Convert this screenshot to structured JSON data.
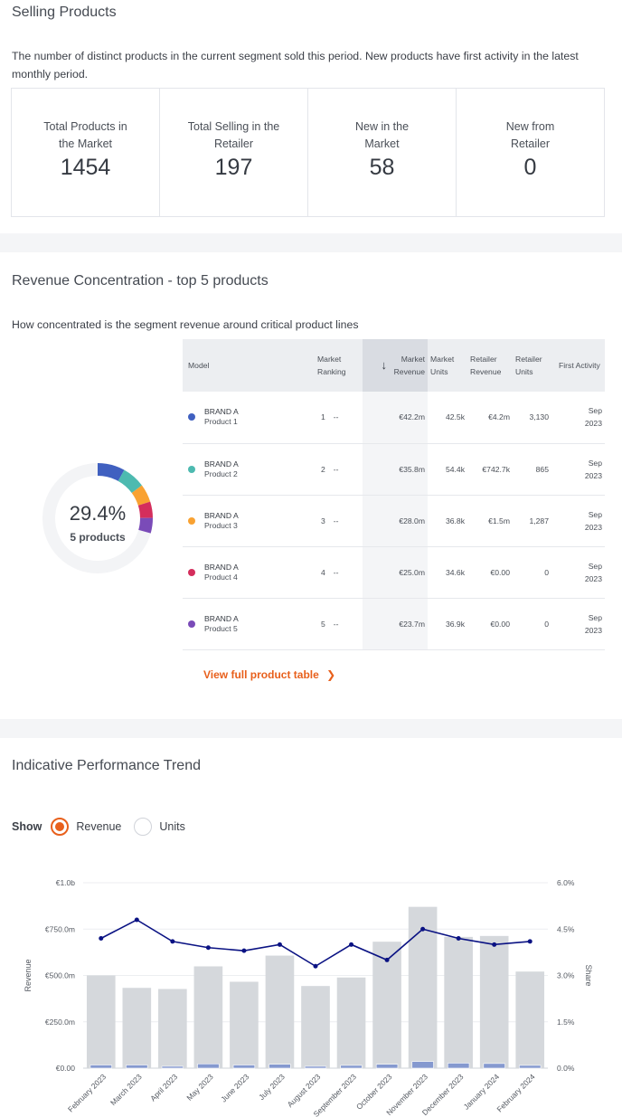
{
  "selling": {
    "title": "Selling Products",
    "description": "The number of distinct products in the current segment sold this period. New products have first activity in the latest monthly period.",
    "kpis": [
      {
        "label": "Total Products in the Market",
        "value": "1454"
      },
      {
        "label": "Total Selling in the Retailer",
        "value": "197"
      },
      {
        "label": "New in the Market",
        "value": "58"
      },
      {
        "label": "New from Retailer",
        "value": "0"
      }
    ]
  },
  "concentration": {
    "title": "Revenue Concentration - top 5 products",
    "description": "How concentrated is the segment revenue around critical product lines",
    "donut": {
      "share_label": "29.4%",
      "share": 0.294,
      "count_label": "5 products",
      "track_color": "#f3f4f6"
    },
    "columns": [
      "Model",
      "Market Ranking",
      "Market Revenue",
      "Market Units",
      "Retailer Revenue",
      "Retailer Units",
      "First Activity"
    ],
    "sort_icon": "arrow-down-icon",
    "rows": [
      {
        "brand": "BRAND A",
        "product": "Product 1",
        "color": "#4060c0",
        "rank": "1",
        "change": "--",
        "market_revenue": "€42.2m",
        "revenue_value": 42.2,
        "market_units": "42.5k",
        "retailer_revenue": "€4.2m",
        "retailer_units": "3,130",
        "first_month": "Sep",
        "first_year": "2023"
      },
      {
        "brand": "BRAND A",
        "product": "Product 2",
        "color": "#4dbab0",
        "rank": "2",
        "change": "--",
        "market_revenue": "€35.8m",
        "revenue_value": 35.8,
        "market_units": "54.4k",
        "retailer_revenue": "€742.7k",
        "retailer_units": "865",
        "first_month": "Sep",
        "first_year": "2023"
      },
      {
        "brand": "BRAND A",
        "product": "Product 3",
        "color": "#f9a232",
        "rank": "3",
        "change": "--",
        "market_revenue": "€28.0m",
        "revenue_value": 28.0,
        "market_units": "36.8k",
        "retailer_revenue": "€1.5m",
        "retailer_units": "1,287",
        "first_month": "Sep",
        "first_year": "2023"
      },
      {
        "brand": "BRAND A",
        "product": "Product 4",
        "color": "#d42e5c",
        "rank": "4",
        "change": "--",
        "market_revenue": "€25.0m",
        "revenue_value": 25.0,
        "market_units": "34.6k",
        "retailer_revenue": "€0.00",
        "retailer_units": "0",
        "first_month": "Sep",
        "first_year": "2023"
      },
      {
        "brand": "BRAND A",
        "product": "Product 5",
        "color": "#7a4bb8",
        "rank": "5",
        "change": "--",
        "market_revenue": "€23.7m",
        "revenue_value": 23.7,
        "market_units": "36.9k",
        "retailer_revenue": "€0.00",
        "retailer_units": "0",
        "first_month": "Sep",
        "first_year": "2023"
      }
    ],
    "link_label": "View full product table",
    "link_icon": "chevron-right-icon"
  },
  "trend": {
    "title": "Indicative Performance Trend",
    "show_label": "Show",
    "options": [
      {
        "label": "Revenue",
        "selected": true
      },
      {
        "label": "Units",
        "selected": false
      }
    ],
    "colors": {
      "market_bar": "#d5d8dc",
      "retailer_bar": "#8599cf",
      "share_line": "#0a1283",
      "accent": "#e8601c"
    }
  },
  "chart_data": {
    "type": "bar",
    "categories": [
      "February 2023",
      "March 2023",
      "April 2023",
      "May 2023",
      "June 2023",
      "July 2023",
      "August 2023",
      "September 2023",
      "October 2023",
      "November 2023",
      "December 2023",
      "January 2024",
      "February 2024"
    ],
    "series": [
      {
        "name": "Market Revenue",
        "type": "bar",
        "axis": "left",
        "values": [
          500,
          433,
          427,
          549,
          466,
          607,
          443,
          489,
          682,
          870,
          708,
          713,
          521
        ]
      },
      {
        "name": "Retailer Revenue",
        "type": "bar",
        "axis": "left",
        "values": [
          17,
          17,
          10,
          23,
          17,
          21,
          10,
          15,
          21,
          36,
          27,
          25,
          15
        ]
      },
      {
        "name": "Share",
        "type": "line",
        "axis": "right",
        "values": [
          4.2,
          4.8,
          4.1,
          3.9,
          3.8,
          4.0,
          3.3,
          4.0,
          3.5,
          4.5,
          4.2,
          4.0,
          4.1
        ]
      }
    ],
    "ylabel": "Revenue",
    "y2label": "Share",
    "ylim": [
      0,
      1000
    ],
    "y2lim": [
      0,
      6
    ],
    "yticks": [
      "€0.00",
      "€250.0m",
      "€500.0m",
      "€750.0m",
      "€1.0b"
    ],
    "y2ticks": [
      "0.0%",
      "1.5%",
      "3.0%",
      "4.5%",
      "6.0%"
    ],
    "units": "€m",
    "grid": true
  }
}
